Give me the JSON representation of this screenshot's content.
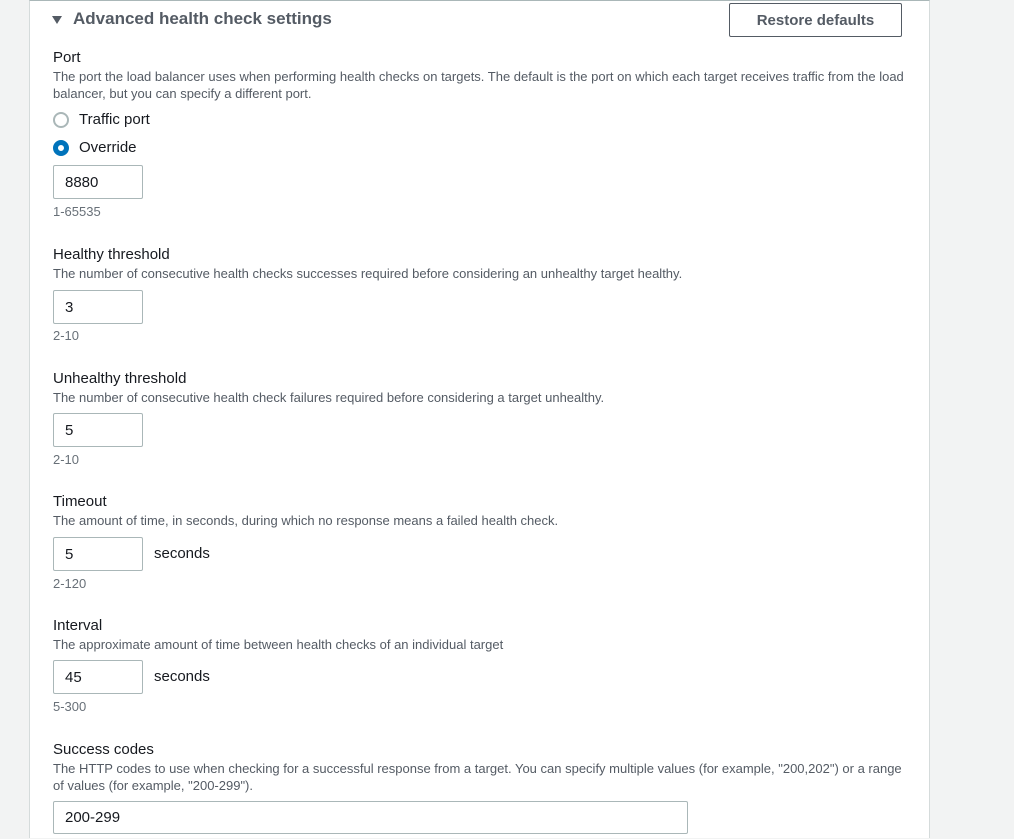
{
  "section": {
    "title": "Advanced health check settings",
    "restore_label": "Restore defaults"
  },
  "port": {
    "label": "Port",
    "description": "The port the load balancer uses when performing health checks on targets. The default is the port on which each target receives traffic from the load balancer, but you can specify a different port.",
    "options": [
      {
        "label": "Traffic port",
        "selected": false
      },
      {
        "label": "Override",
        "selected": true
      }
    ],
    "value": "8880",
    "constraint": "1-65535"
  },
  "healthy_threshold": {
    "label": "Healthy threshold",
    "description": "The number of consecutive health checks successes required before considering an unhealthy target healthy.",
    "value": "3",
    "constraint": "2-10"
  },
  "unhealthy_threshold": {
    "label": "Unhealthy threshold",
    "description": "The number of consecutive health check failures required before considering a target unhealthy.",
    "value": "5",
    "constraint": "2-10"
  },
  "timeout": {
    "label": "Timeout",
    "description": "The amount of time, in seconds, during which no response means a failed health check.",
    "value": "5",
    "unit": "seconds",
    "constraint": "2-120"
  },
  "interval": {
    "label": "Interval",
    "description": "The approximate amount of time between health checks of an individual target",
    "value": "45",
    "unit": "seconds",
    "constraint": "5-300"
  },
  "success_codes": {
    "label": "Success codes",
    "description": "The HTTP codes to use when checking for a successful response from a target. You can specify multiple values (for example, \"200,202\") or a range of values (for example, \"200-299\").",
    "value": "200-299"
  },
  "colors": {
    "accent": "#0073bb",
    "border": "#aab7b8",
    "text": "#16191f",
    "secondary_text": "#545b64"
  }
}
